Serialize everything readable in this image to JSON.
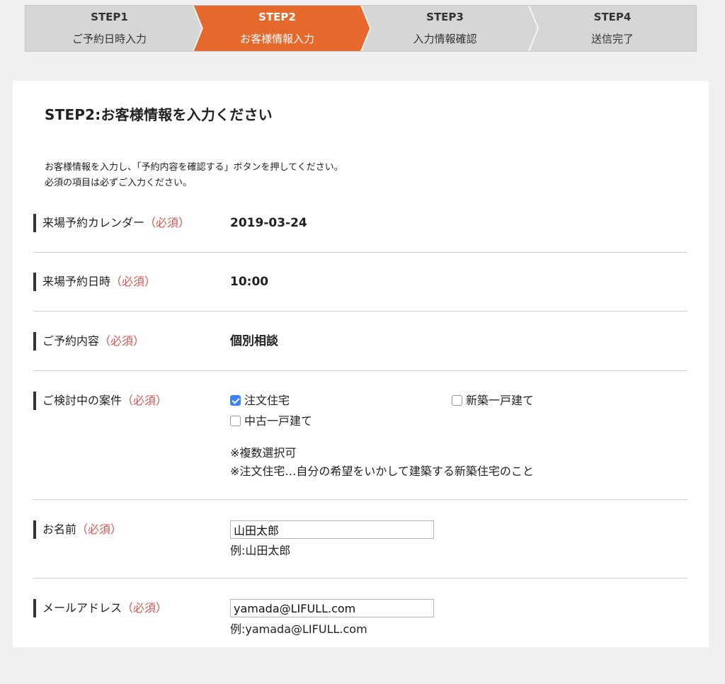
{
  "steps": [
    {
      "num": "STEP1",
      "label": "ご予約日時入力"
    },
    {
      "num": "STEP2",
      "label": "お客様情報入力"
    },
    {
      "num": "STEP3",
      "label": "入力情報確認"
    },
    {
      "num": "STEP4",
      "label": "送信完了"
    }
  ],
  "colors": {
    "active_step": "#e5692c",
    "inactive_step": "#d6d6d6",
    "required": "#d9534f",
    "checkbox_on": "#3b82f6"
  },
  "title": "STEP2:お客様情報を入力ください",
  "intro": {
    "line1": "お客様情報を入力し、「予約内容を確認する」ボタンを押してください。",
    "line2": "必須の項目は必ずご入力ください。"
  },
  "required_mark": "（必須）",
  "fields": {
    "calendar": {
      "label": "来場予約カレンダー",
      "value": "2019-03-24"
    },
    "time": {
      "label": "来場予約日時",
      "value": "10:00"
    },
    "content": {
      "label": "ご予約内容",
      "value": "個別相談"
    },
    "case": {
      "label": "ご検討中の案件",
      "options": [
        {
          "label": "注文住宅",
          "checked": true
        },
        {
          "label": "新築一戸建て",
          "checked": false
        },
        {
          "label": "中古一戸建て",
          "checked": false
        }
      ],
      "note1": "※複数選択可",
      "note2": "※注文住宅…自分の希望をいかして建築する新築住宅のこと"
    },
    "name": {
      "label": "お名前",
      "value": "山田太郎",
      "example": "例:山田太郎"
    },
    "email": {
      "label": "メールアドレス",
      "value": "yamada@LIFULL.com",
      "example": "例:yamada@LIFULL.com"
    }
  }
}
